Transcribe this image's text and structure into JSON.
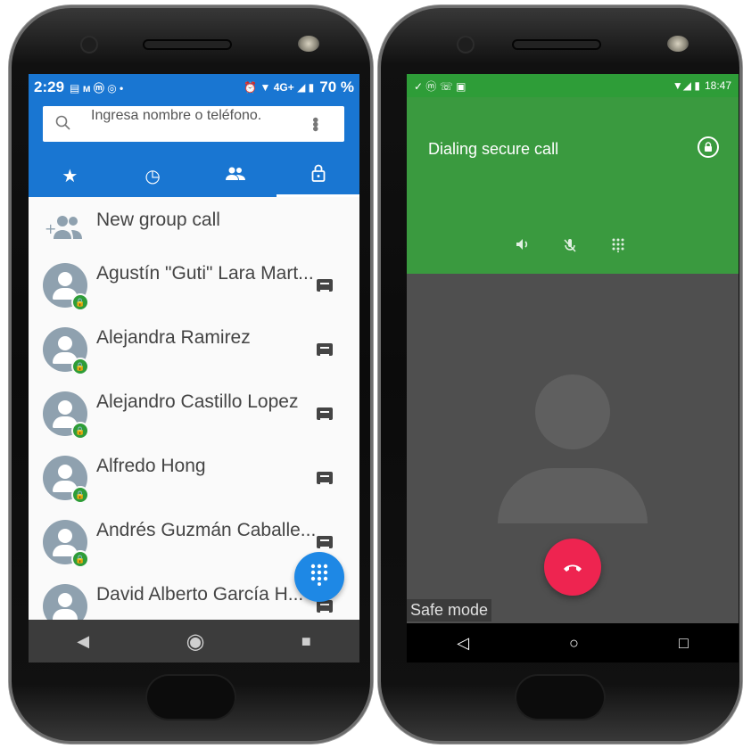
{
  "left": {
    "status_bar": {
      "time": "2:29",
      "left_icons": "▤ ᴍ ⓜ ◎ •",
      "right_icons": "⏰ ▼ 4G+ ◢ ▮",
      "battery": "70 %"
    },
    "search": {
      "placeholder": "Ingresa nombre o teléfono."
    },
    "tabs": [
      {
        "icon": "star-icon",
        "glyph": "★"
      },
      {
        "icon": "clock-icon",
        "glyph": "◷"
      },
      {
        "icon": "people-icon",
        "glyph": "👥"
      },
      {
        "icon": "lock-icon",
        "glyph": "🔓"
      }
    ],
    "new_group_call": "New group call",
    "contacts": [
      "Agustín \"Guti\" Lara Mart...",
      "Alejandra Ramirez",
      "Alejandro Castillo Lopez",
      "Alfredo Hong",
      "Andrés Guzmán Caballe...",
      "David Alberto García H..."
    ],
    "nav": {
      "back": "◀",
      "home": "◉",
      "recents": "■"
    }
  },
  "right": {
    "status_bar": {
      "left_icons": "✓ ⓜ ☏ ▣",
      "right_icons": "▼◢ ▮",
      "time": "18:47"
    },
    "call_status": "Dialing secure call",
    "controls": {
      "speaker": "🔈",
      "mute": "✕",
      "keypad": "⋮⋮"
    },
    "safe_mode": "Safe mode",
    "nav": {
      "back": "◁",
      "home": "○",
      "recents": "□"
    }
  },
  "colors": {
    "primary_blue": "#1976d2",
    "call_green": "#3a9a3f",
    "end_call_red": "#ee2450",
    "secure_badge": "#2e9d38"
  }
}
